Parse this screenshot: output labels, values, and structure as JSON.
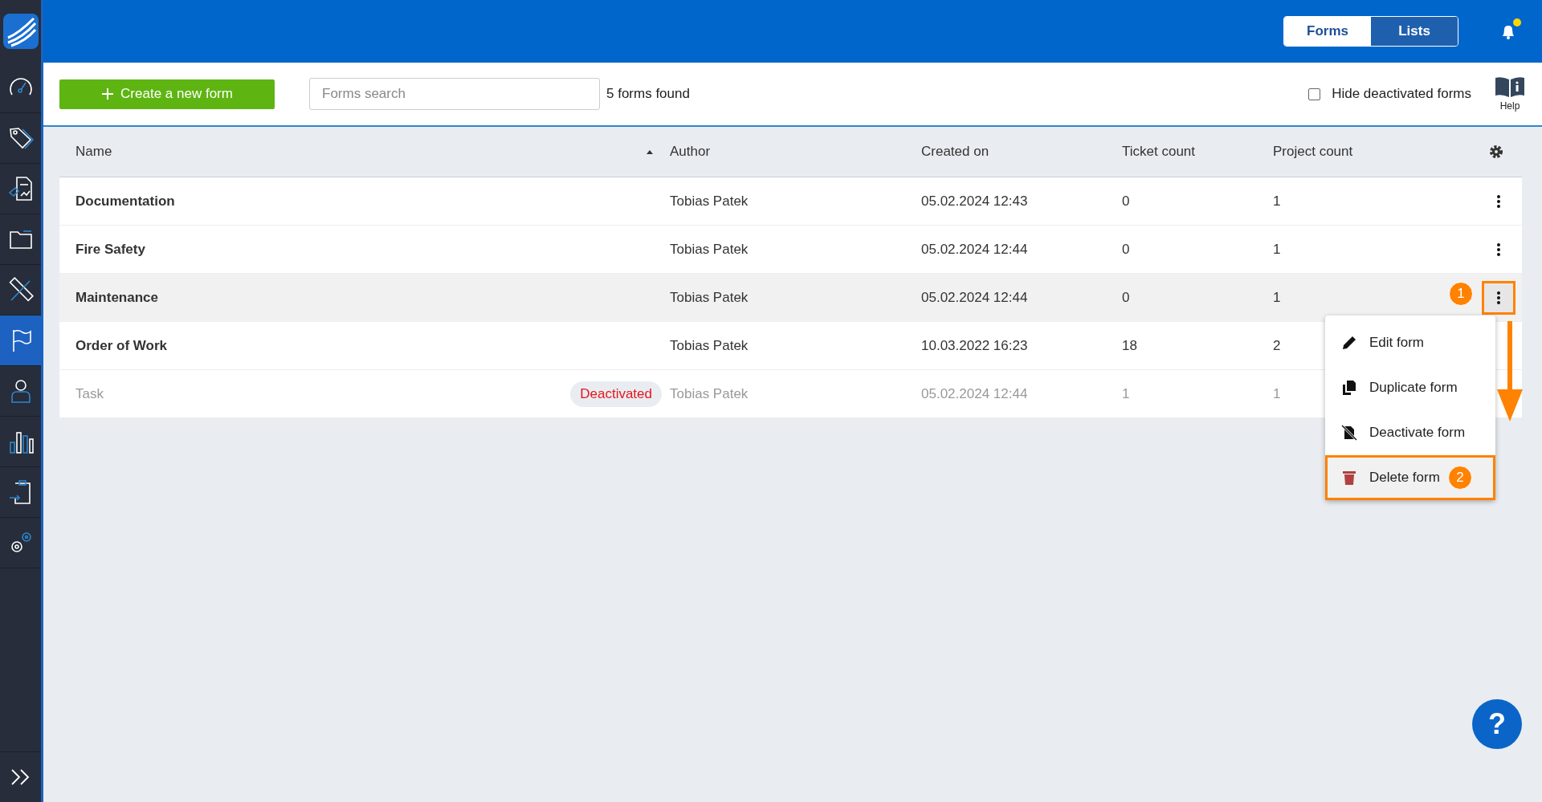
{
  "sidebar": {
    "items": [
      {
        "kind": "dashboard",
        "selected": false
      },
      {
        "kind": "tags",
        "selected": false
      },
      {
        "kind": "report",
        "selected": false
      },
      {
        "kind": "folder",
        "selected": false
      },
      {
        "kind": "tools",
        "selected": false
      },
      {
        "kind": "flag",
        "selected": true
      },
      {
        "kind": "person",
        "selected": false
      },
      {
        "kind": "chart",
        "selected": false
      },
      {
        "kind": "clipboard",
        "selected": false
      },
      {
        "kind": "gears",
        "selected": false
      }
    ]
  },
  "top_bar": {
    "tabs": [
      {
        "label": "Forms",
        "selected": true
      },
      {
        "label": "Lists",
        "selected": false
      }
    ],
    "notification_dot": true
  },
  "toolbar": {
    "create_button": "Create a new form",
    "search": {
      "placeholder": "Forms search"
    },
    "result_count": "5 forms found",
    "hide_deactivated": {
      "label": "Hide deactivated forms",
      "checked": false
    },
    "help": "Help"
  },
  "table": {
    "columns": [
      "Name",
      "Author",
      "Created on",
      "Ticket count",
      "Project count"
    ],
    "rows": [
      {
        "name": "Documentation",
        "author": "Tobias Patek",
        "created_on": "05.02.2024 12:43",
        "ticket_count": "0",
        "project_count": "1",
        "selected": false,
        "deactivated": false
      },
      {
        "name": "Fire Safety",
        "author": "Tobias Patek",
        "created_on": "05.02.2024 12:44",
        "ticket_count": "0",
        "project_count": "1",
        "selected": false,
        "deactivated": false
      },
      {
        "name": "Maintenance",
        "author": "Tobias Patek",
        "created_on": "05.02.2024 12:44",
        "ticket_count": "0",
        "project_count": "1",
        "selected": true,
        "deactivated": false
      },
      {
        "name": "Order of Work",
        "author": "Tobias Patek",
        "created_on": "10.03.2022 16:23",
        "ticket_count": "18",
        "project_count": "2",
        "selected": false,
        "deactivated": false
      },
      {
        "name": "Task",
        "author": "Tobias Patek",
        "created_on": "05.02.2024 12:44",
        "ticket_count": "1",
        "project_count": "1",
        "selected": false,
        "deactivated": true,
        "badge": "Deactivated"
      }
    ]
  },
  "context_menu": {
    "items": [
      {
        "kind": "edit",
        "label": "Edit form",
        "highlighted": false
      },
      {
        "kind": "duplicate",
        "label": "Duplicate form",
        "highlighted": false
      },
      {
        "kind": "deactivate",
        "label": "Deactivate form",
        "highlighted": false
      },
      {
        "kind": "delete",
        "label": "Delete form",
        "highlighted": true
      }
    ]
  },
  "annotations": [
    "1",
    "2"
  ],
  "help_fab": "?"
}
